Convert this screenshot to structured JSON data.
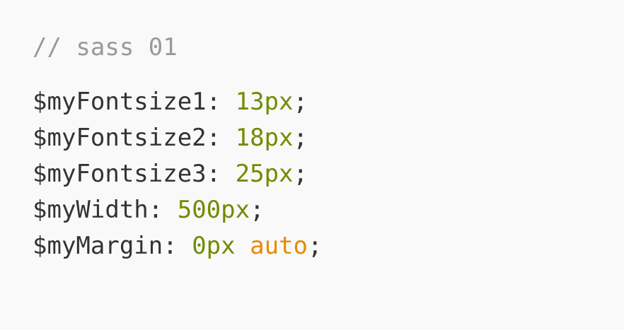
{
  "code": {
    "comment": "// sass 01",
    "lines": [
      {
        "name": "$myFontsize1",
        "colon": ": ",
        "value": "13px",
        "keyword": "",
        "terminator": ";"
      },
      {
        "name": "$myFontsize2",
        "colon": ": ",
        "value": "18px",
        "keyword": "",
        "terminator": ";"
      },
      {
        "name": "$myFontsize3",
        "colon": ": ",
        "value": "25px",
        "keyword": "",
        "terminator": ";"
      },
      {
        "name": "$myWidth",
        "colon": ": ",
        "value": "500px",
        "keyword": "",
        "terminator": ";"
      },
      {
        "name": "$myMargin",
        "colon": ": ",
        "value": "0px",
        "keyword": "auto",
        "terminator": ";"
      }
    ]
  },
  "colors": {
    "background": "#f9f9f9",
    "text": "#333333",
    "comment": "#999999",
    "value": "#718c00",
    "keyword": "#e88a00"
  }
}
